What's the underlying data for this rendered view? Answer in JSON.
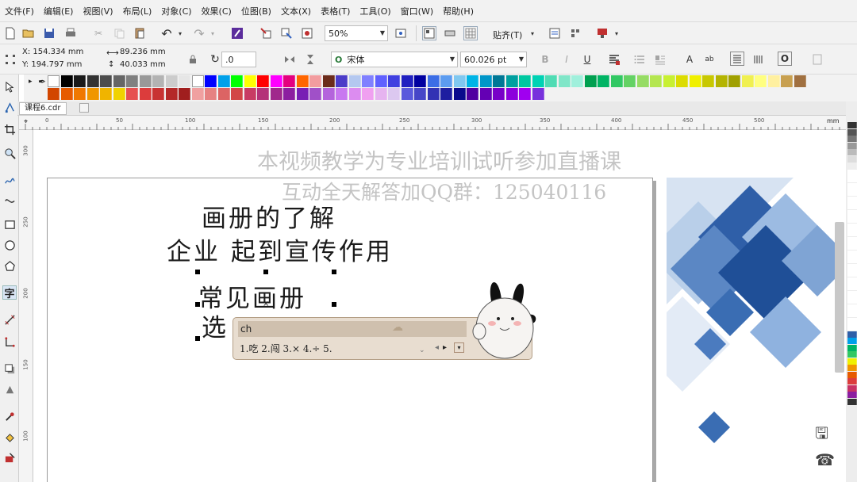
{
  "menubar": {
    "items": [
      "文件(F)",
      "编辑(E)",
      "视图(V)",
      "布局(L)",
      "对象(C)",
      "效果(C)",
      "位图(B)",
      "文本(X)",
      "表格(T)",
      "工具(O)",
      "窗口(W)",
      "帮助(H)"
    ]
  },
  "toolbar1": {
    "zoom": "50%",
    "snap_label": "贴齐(T)"
  },
  "property_bar": {
    "x": "X: 154.334 mm",
    "y": "Y: 194.797 mm",
    "width": "89.236 mm",
    "height": "40.033 mm",
    "rotation": ".0",
    "font_name": "宋体",
    "font_size": "60.026 pt"
  },
  "palette": {
    "row1": [
      "#ffffff",
      "#000000",
      "#1a1a1a",
      "#333333",
      "#4d4d4d",
      "#666666",
      "#808080",
      "#999999",
      "#b3b3b3",
      "#cccccc",
      "#e6e6e6",
      "#ffffff",
      "#0000ff",
      "#00a0e9",
      "#00ff00",
      "#ffff00",
      "#ff0000",
      "#ff00ff",
      "#e4007f",
      "#ff6600",
      "#f29c9f",
      "#6b2c1b",
      "#4b3cc8",
      "#b4c8f0",
      "#8080ff",
      "#6060ff",
      "#4040e0",
      "#2020c0",
      "#0000a0",
      "#3c6ee6",
      "#5c9cf0",
      "#80c8f0",
      "#00b4e6",
      "#0096c8",
      "#007896",
      "#00a0a0",
      "#00c8a0",
      "#00d2b4",
      "#50dcb4",
      "#80e6c8",
      "#a0f0dc",
      "#00a050",
      "#00b464",
      "#32c864",
      "#64d264",
      "#96dc64",
      "#b4e650",
      "#c8f032",
      "#dcdc00",
      "#f0f000",
      "#c8c800",
      "#b4b400",
      "#a0a000",
      "#f0f050",
      "#ffff80",
      "#fff0a0",
      "#c8a050",
      "#a07040"
    ],
    "row2": [
      "#d24600",
      "#e65a00",
      "#f07800",
      "#f09600",
      "#f0b400",
      "#f0d200",
      "#e65050",
      "#dc3c3c",
      "#c83232",
      "#b42828",
      "#a01e1e",
      "#f0a0a0",
      "#e68282",
      "#dc6464",
      "#d24646",
      "#c83c64",
      "#b43278",
      "#a0288c",
      "#8c1ea0",
      "#781eb4",
      "#a050c8",
      "#b464dc",
      "#c878f0",
      "#dc8cf0",
      "#f0a0f0",
      "#e6b4f0",
      "#dcc8f0",
      "#5a5adc",
      "#4646c8",
      "#3232b4",
      "#1e1ea0",
      "#0a0a8c",
      "#5000a0",
      "#6400b4",
      "#7800c8",
      "#8c00dc",
      "#a000f0",
      "#7832dc"
    ]
  },
  "document_tab": {
    "filename": "课程6.cdr"
  },
  "ruler": {
    "h_labels": [
      "0",
      "50",
      "100",
      "150",
      "200",
      "250",
      "300",
      "350",
      "400",
      "450",
      "500"
    ],
    "v_labels": [
      "300",
      "250",
      "200",
      "150",
      "100"
    ]
  },
  "watermark": {
    "line1": "本视频教学为专业培训试听参加直播课",
    "line2": "互动全天解答加QQ群：125040116"
  },
  "page_text": {
    "line1": "画册的了解",
    "line2": "企业 起到宣传作用",
    "line3": "常见画册",
    "line4": "选"
  },
  "ime": {
    "input": "ch",
    "candidates": "1.吃  2.闯  3.×  4.÷  5."
  },
  "colors": {
    "accent_blue": "#2f5fa8",
    "light_blue": "#a9c4e6",
    "chrome": "#f2f2f2"
  }
}
